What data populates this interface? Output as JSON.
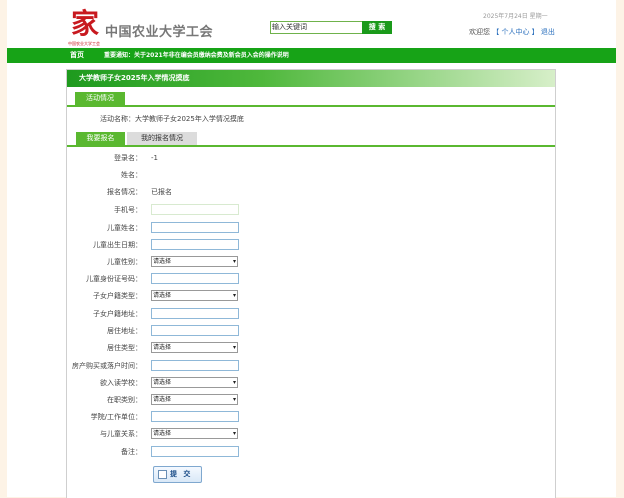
{
  "header": {
    "logo_char": "家",
    "logo_tagline": "中国农业大学工会",
    "site_title": "中国农业大学工会",
    "search": {
      "placeholder": "输入关键词",
      "button": "搜 索"
    },
    "date": "2025年7月24日  星期一",
    "welcome": "欢迎您",
    "personal_center": "【 个人中心 】",
    "logout": "退出"
  },
  "nav": {
    "home": "首页",
    "notice": "重要通知：关于2021年非在编会员缴纳会费及新会员入会的操作说明"
  },
  "panel": {
    "title": "大学教师子女2025年入学情况摸底",
    "tab_activity": "活动情况",
    "activity_name": "活动名称：大学教师子女2025年入学情况摸底",
    "tab_register": "我要报名",
    "tab_my": "我的报名情况"
  },
  "form": {
    "fields": [
      {
        "label": "登录名：",
        "type": "text",
        "value": "-1"
      },
      {
        "label": "姓名：",
        "type": "text",
        "value": ""
      },
      {
        "label": "报名情况：",
        "type": "text",
        "value": "已报名"
      },
      {
        "label": "手机号：",
        "type": "input-light",
        "value": ""
      },
      {
        "label": "儿童姓名：",
        "type": "input",
        "value": ""
      },
      {
        "label": "儿童出生日期：",
        "type": "input",
        "value": ""
      },
      {
        "label": "儿童性别：",
        "type": "select",
        "value": "请选择"
      },
      {
        "label": "儿童身份证号码：",
        "type": "input",
        "value": ""
      },
      {
        "label": "子女户籍类型：",
        "type": "select",
        "value": "请选择"
      },
      {
        "label": "子女户籍地址：",
        "type": "input",
        "value": ""
      },
      {
        "label": "居住地址：",
        "type": "input",
        "value": ""
      },
      {
        "label": "居住类型：",
        "type": "select",
        "value": "请选择"
      },
      {
        "label": "房产购买或落户时间：",
        "type": "input",
        "value": ""
      },
      {
        "label": "欲入读学校：",
        "type": "select",
        "value": "请选择"
      },
      {
        "label": "在职类别：",
        "type": "select",
        "value": "请选择"
      },
      {
        "label": "学院/工作单位：",
        "type": "input",
        "value": ""
      },
      {
        "label": "与儿童关系：",
        "type": "select",
        "value": "请选择"
      },
      {
        "label": "备注：",
        "type": "input",
        "value": ""
      }
    ],
    "submit": "提 交"
  }
}
